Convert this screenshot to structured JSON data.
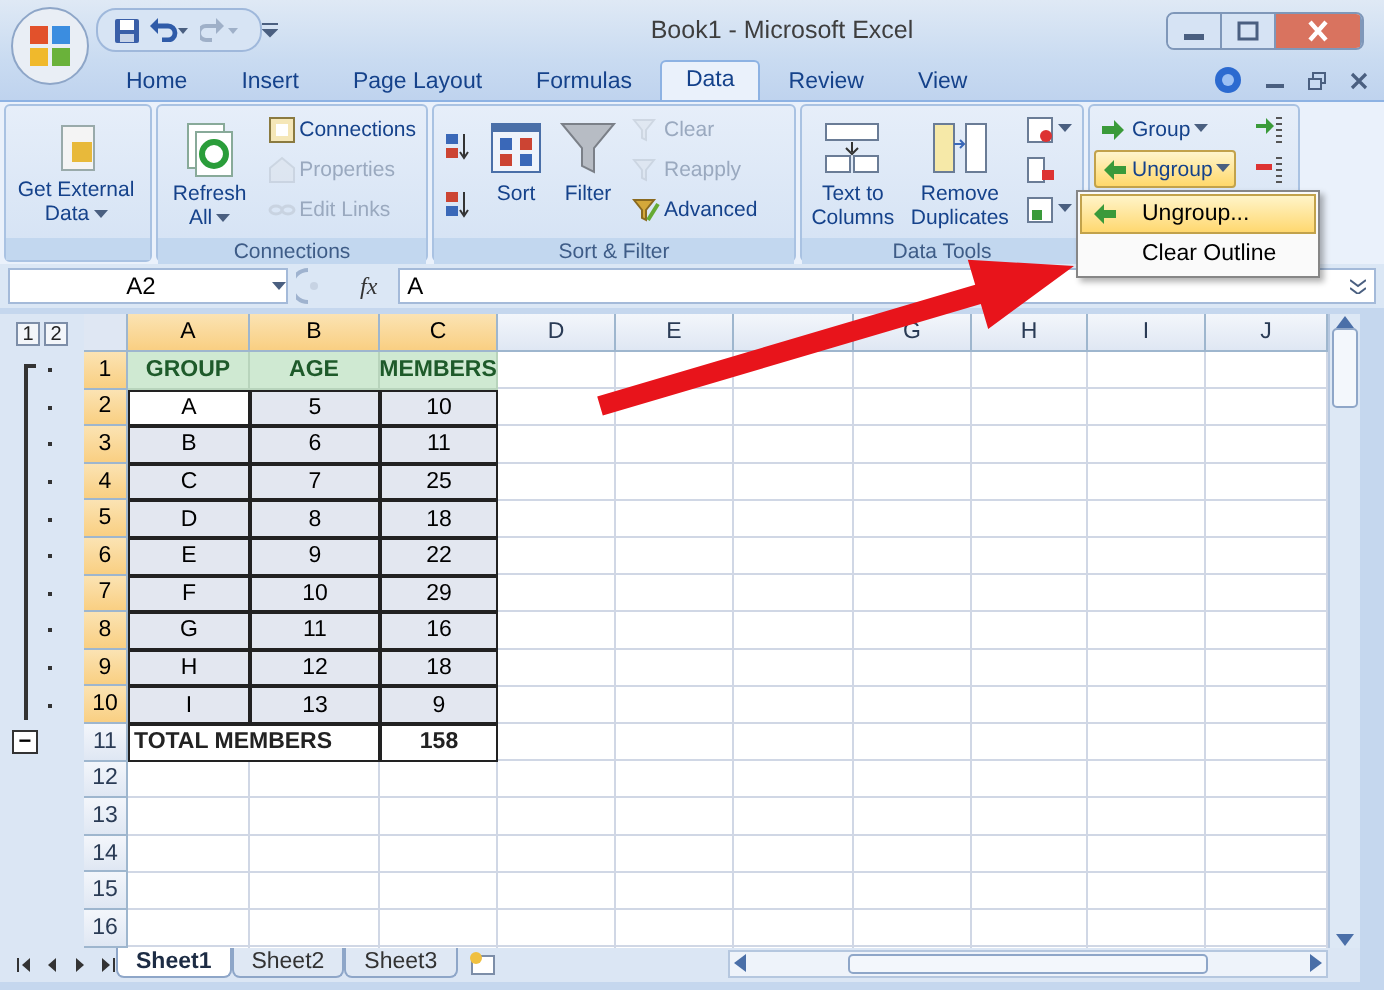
{
  "window": {
    "title": "Book1 - Microsoft Excel"
  },
  "tabs": [
    {
      "label": "Home",
      "selected": false
    },
    {
      "label": "Insert",
      "selected": false
    },
    {
      "label": "Page Layout",
      "selected": false
    },
    {
      "label": "Formulas",
      "selected": false
    },
    {
      "label": "Data",
      "selected": true
    },
    {
      "label": "Review",
      "selected": false
    },
    {
      "label": "View",
      "selected": false
    }
  ],
  "ribbon_groups": [
    {
      "columns": [
        [
          {
            "kind": "large",
            "label": "Get External Data",
            "disabled": false,
            "dropdown": true,
            "highlighted": false
          }
        ]
      ]
    },
    {
      "title": "Connections",
      "columns": [
        [
          {
            "kind": "large",
            "label": "Refresh All",
            "disabled": false,
            "dropdown": true,
            "highlighted": false
          }
        ],
        [
          {
            "kind": "small",
            "label": "Connections",
            "disabled": false,
            "dropdown": false,
            "highlighted": false
          },
          {
            "kind": "small",
            "label": "Properties",
            "disabled": true,
            "dropdown": false,
            "highlighted": false
          },
          {
            "kind": "small",
            "label": "Edit Links",
            "disabled": true,
            "dropdown": false,
            "highlighted": false
          }
        ]
      ]
    },
    {
      "title": "Sort & Filter",
      "columns": [
        [
          {
            "kind": "icon",
            "disabled": false,
            "dropdown": false,
            "highlighted": false
          },
          {
            "kind": "icon",
            "disabled": false,
            "dropdown": false,
            "highlighted": false
          }
        ],
        [
          {
            "kind": "large",
            "label": "Sort",
            "disabled": false,
            "dropdown": false,
            "highlighted": false
          }
        ],
        [
          {
            "kind": "large",
            "label": "Filter",
            "disabled": false,
            "dropdown": false,
            "highlighted": false
          }
        ],
        [
          {
            "kind": "small",
            "label": "Clear",
            "disabled": true,
            "dropdown": false,
            "highlighted": false
          },
          {
            "kind": "small",
            "label": "Reapply",
            "disabled": true,
            "dropdown": false,
            "highlighted": false
          },
          {
            "kind": "small",
            "label": "Advanced",
            "disabled": false,
            "dropdown": false,
            "highlighted": false
          }
        ]
      ]
    },
    {
      "title": "Data Tools",
      "columns": [
        [
          {
            "kind": "large",
            "label": "Text to Columns",
            "disabled": false,
            "dropdown": false,
            "highlighted": false
          }
        ],
        [
          {
            "kind": "large",
            "label": "Remove Duplicates",
            "disabled": false,
            "dropdown": false,
            "highlighted": false
          }
        ],
        [
          {
            "kind": "icon",
            "disabled": false,
            "dropdown": true,
            "highlighted": false
          },
          {
            "kind": "icon",
            "disabled": false,
            "dropdown": false,
            "highlighted": false
          },
          {
            "kind": "icon",
            "disabled": false,
            "dropdown": true,
            "highlighted": false
          }
        ]
      ]
    },
    {
      "columns": [
        [
          {
            "kind": "small",
            "label": "Group",
            "disabled": false,
            "dropdown": true,
            "highlighted": false
          },
          {
            "kind": "small",
            "label": "Ungroup",
            "disabled": false,
            "dropdown": true,
            "highlighted": true
          }
        ],
        [
          {
            "kind": "icon",
            "disabled": false,
            "dropdown": false,
            "highlighted": false
          },
          {
            "kind": "icon",
            "disabled": false,
            "dropdown": false,
            "highlighted": false
          }
        ]
      ]
    }
  ],
  "menu": {
    "items": [
      {
        "label": "Ungroup...",
        "highlighted": true
      },
      {
        "label": "Clear Outline",
        "highlighted": false
      }
    ]
  },
  "formula_bar": {
    "name_box": "A2",
    "function_label": "fx",
    "value": "A"
  },
  "outline": {
    "levels": [
      "1",
      "2"
    ],
    "collapse_button": "−"
  },
  "columns": [
    {
      "label": "A",
      "highlighted": true
    },
    {
      "label": "B",
      "highlighted": true
    },
    {
      "label": "C",
      "highlighted": true
    },
    {
      "label": "D",
      "highlighted": false
    },
    {
      "label": "E",
      "highlighted": false
    },
    {
      "highlighted": false
    },
    {
      "label": "G",
      "highlighted": false
    },
    {
      "label": "H",
      "highlighted": false
    },
    {
      "label": "I",
      "highlighted": false
    },
    {
      "label": "J",
      "highlighted": false
    }
  ],
  "rows": [
    {
      "label": "1",
      "highlighted": true,
      "kind": "detail",
      "cells": [
        {
          "text": "GROUP",
          "kind": "header"
        },
        {
          "text": "AGE",
          "kind": "header"
        },
        {
          "text": "MEMBERS",
          "kind": "header"
        }
      ]
    },
    {
      "label": "2",
      "highlighted": true,
      "kind": "detail",
      "cells": [
        {
          "text": "A",
          "kind": "active"
        },
        {
          "text": "5",
          "kind": "range"
        },
        {
          "text": "10",
          "kind": "range"
        }
      ]
    },
    {
      "label": "3",
      "highlighted": true,
      "kind": "detail",
      "cells": [
        {
          "text": "B",
          "kind": "range"
        },
        {
          "text": "6",
          "kind": "range"
        },
        {
          "text": "11",
          "kind": "range"
        }
      ]
    },
    {
      "label": "4",
      "highlighted": true,
      "kind": "detail",
      "cells": [
        {
          "text": "C",
          "kind": "range"
        },
        {
          "text": "7",
          "kind": "range"
        },
        {
          "text": "25",
          "kind": "range"
        }
      ]
    },
    {
      "label": "5",
      "highlighted": true,
      "kind": "detail",
      "cells": [
        {
          "text": "D",
          "kind": "range"
        },
        {
          "text": "8",
          "kind": "range"
        },
        {
          "text": "18",
          "kind": "range"
        }
      ]
    },
    {
      "label": "6",
      "highlighted": true,
      "kind": "detail",
      "cells": [
        {
          "text": "E",
          "kind": "range"
        },
        {
          "text": "9",
          "kind": "range"
        },
        {
          "text": "22",
          "kind": "range"
        }
      ]
    },
    {
      "label": "7",
      "highlighted": true,
      "kind": "detail",
      "cells": [
        {
          "text": "F",
          "kind": "range"
        },
        {
          "text": "10",
          "kind": "range"
        },
        {
          "text": "29",
          "kind": "range"
        }
      ]
    },
    {
      "label": "8",
      "highlighted": true,
      "kind": "detail",
      "cells": [
        {
          "text": "G",
          "kind": "range"
        },
        {
          "text": "11",
          "kind": "range"
        },
        {
          "text": "16",
          "kind": "range"
        }
      ]
    },
    {
      "label": "9",
      "highlighted": true,
      "kind": "detail",
      "cells": [
        {
          "text": "H",
          "kind": "range"
        },
        {
          "text": "12",
          "kind": "range"
        },
        {
          "text": "18",
          "kind": "range"
        }
      ]
    },
    {
      "label": "10",
      "highlighted": true,
      "kind": "detail",
      "cells": [
        {
          "text": "I",
          "kind": "range"
        },
        {
          "text": "13",
          "kind": "range"
        },
        {
          "text": "9",
          "kind": "range"
        }
      ]
    },
    {
      "label": "11",
      "highlighted": false,
      "kind": "summary",
      "cells": [
        {
          "text": "TOTAL MEMBERS",
          "kind": "total-label"
        },
        {
          "text": "158",
          "kind": "total"
        }
      ]
    },
    {
      "label": "12",
      "highlighted": false,
      "kind": "plain"
    },
    {
      "label": "13",
      "highlighted": false,
      "kind": "plain"
    },
    {
      "label": "14",
      "highlighted": false,
      "kind": "plain"
    },
    {
      "label": "15",
      "highlighted": false,
      "kind": "plain"
    },
    {
      "label": "16",
      "highlighted": false,
      "kind": "plain"
    }
  ],
  "sheet_tabs": [
    {
      "label": "Sheet1",
      "selected": true
    },
    {
      "label": "Sheet2",
      "selected": false
    },
    {
      "label": "Sheet3",
      "selected": false
    }
  ]
}
